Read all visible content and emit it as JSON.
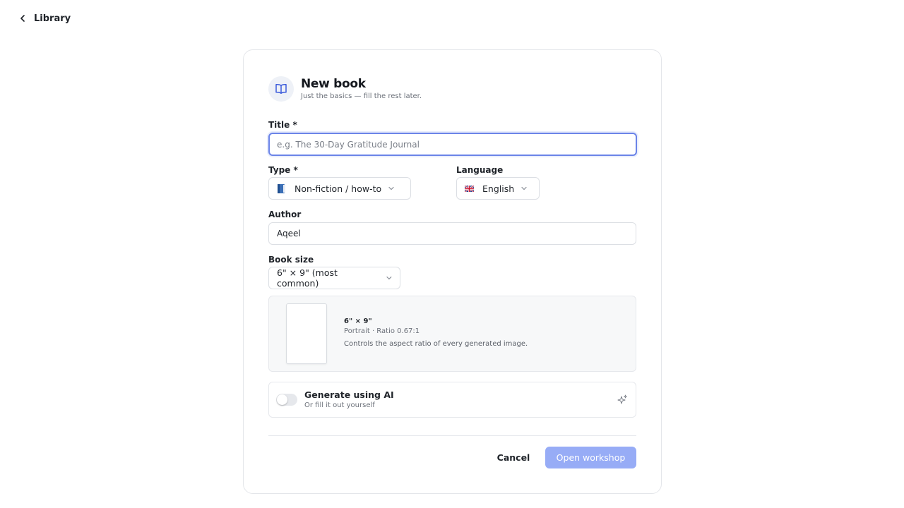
{
  "nav": {
    "back_label": "Library",
    "back_icon": "chevron-left-icon"
  },
  "header": {
    "title": "New book",
    "subtitle": "Just the basics — fill the rest later.",
    "icon": "open-book-icon"
  },
  "form": {
    "title": {
      "label": "Title *",
      "value": "",
      "placeholder": "e.g. The 30-Day Gratitude Journal"
    },
    "type": {
      "label": "Type *",
      "value": "Non-fiction / how-to",
      "icon": "blue-book-icon"
    },
    "language": {
      "label": "Language",
      "value": "English",
      "icon": "uk-flag-icon"
    },
    "author": {
      "label": "Author",
      "value": "Aqeel",
      "placeholder": ""
    },
    "book_size": {
      "label": "Book size",
      "value": "6\" × 9\" (most common)"
    }
  },
  "preview": {
    "size": "6\" × 9\"",
    "meta": "Portrait · Ratio 0.67:1",
    "description": "Controls the aspect ratio of every generated image."
  },
  "ai": {
    "title": "Generate using AI",
    "subtitle": "Or fill it out yourself",
    "enabled": false,
    "icon": "sparkle-icon"
  },
  "actions": {
    "cancel_label": "Cancel",
    "submit_label": "Open workshop"
  },
  "colors": {
    "accent": "#6b84e8",
    "primary_disabled": "#97acf6",
    "border": "#dcdfe4"
  }
}
